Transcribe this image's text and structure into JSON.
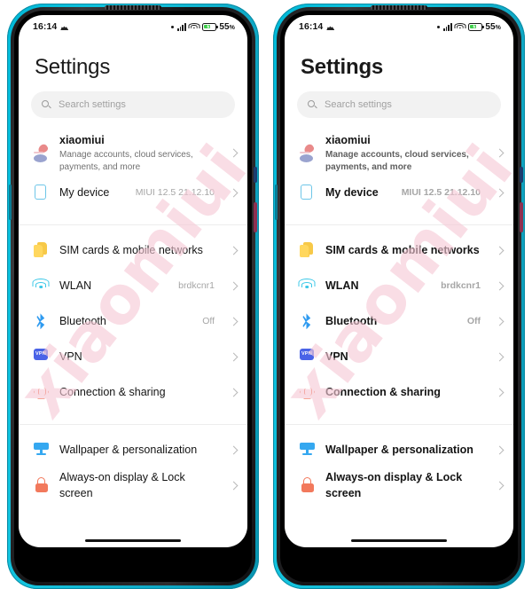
{
  "watermark": {
    "text": "xiaomiui"
  },
  "status_bar": {
    "time": "16:14",
    "alarm_icon": "alarm-icon",
    "signal_icon": "cellular-signal-icon",
    "wifi_icon": "wifi-icon",
    "battery_icon": "battery-charging-icon",
    "battery_percent": "55",
    "battery_percent_suffix": "%"
  },
  "page": {
    "title": "Settings",
    "search": {
      "placeholder": "Search settings",
      "icon": "search-icon"
    }
  },
  "groups": [
    {
      "id": "account-group",
      "rows": [
        {
          "name": "account",
          "icon": "avatar-icon",
          "label": "xiaomiui",
          "sub": "Manage accounts, cloud services, payments, and more",
          "value": ""
        },
        {
          "name": "my-device",
          "icon": "device-icon",
          "label": "My device",
          "sub": "",
          "value": "MIUI 12.5 21.12.10"
        }
      ]
    },
    {
      "id": "connectivity-group",
      "rows": [
        {
          "name": "sim-cards",
          "icon": "sim-card-icon",
          "label": "SIM cards & mobile networks",
          "sub": "",
          "value": ""
        },
        {
          "name": "wlan",
          "icon": "wifi-icon",
          "label": "WLAN",
          "sub": "",
          "value": "brdkcnr1"
        },
        {
          "name": "bluetooth",
          "icon": "bluetooth-icon",
          "label": "Bluetooth",
          "sub": "",
          "value": "Off"
        },
        {
          "name": "vpn",
          "icon": "vpn-icon",
          "label": "VPN",
          "sub": "",
          "value": ""
        },
        {
          "name": "connection-sharing",
          "icon": "connection-sharing-icon",
          "label": "Connection & sharing",
          "sub": "",
          "value": ""
        }
      ]
    },
    {
      "id": "personalization-group",
      "rows": [
        {
          "name": "wallpaper-personalization",
          "icon": "wallpaper-icon",
          "label": "Wallpaper & personalization",
          "sub": "",
          "value": ""
        },
        {
          "name": "always-on-display-lock-screen",
          "icon": "lock-icon",
          "label": "Always-on display & Lock screen",
          "sub": "",
          "value": ""
        }
      ]
    }
  ],
  "colors": {
    "frame_teal": "#15c4de",
    "sim_yellow": "#ffd75e",
    "wifi_cyan": "#3cc8e8",
    "bluetooth_blue": "#2f9bf0",
    "vpn_blue": "#4a63e7",
    "connection_orange": "#f2795c",
    "wallpaper_blue": "#35a8f0",
    "lock_coral": "#f2795c",
    "battery_green": "#3ecf4a",
    "watermark_pink": "#f6c9d6"
  }
}
